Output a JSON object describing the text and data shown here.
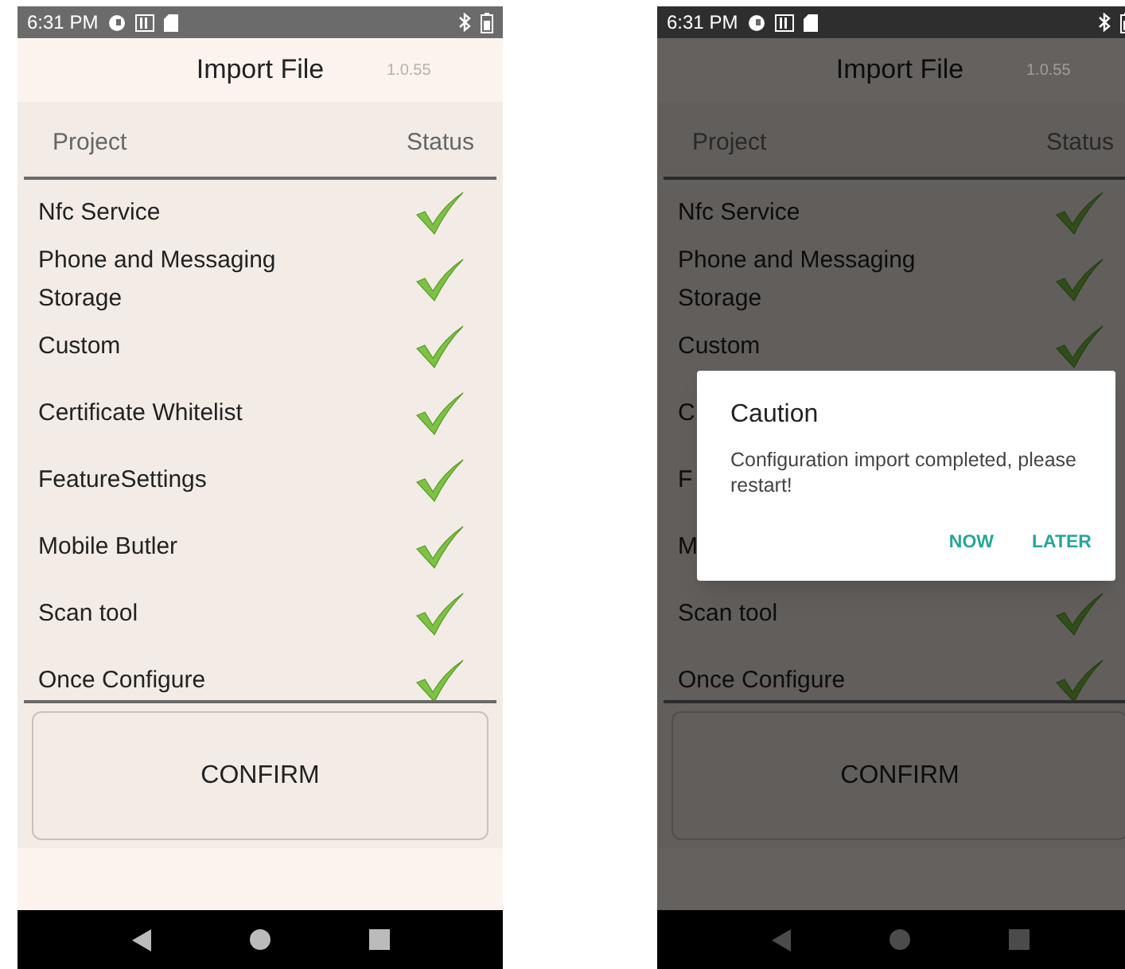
{
  "screens": [
    {
      "status_bar": {
        "time": "6:31 PM"
      },
      "title": "Import File",
      "version": "1.0.55",
      "columns": [
        "Project",
        "Status"
      ],
      "dimmed": false,
      "rows": [
        {
          "label": "Nfc Service",
          "checked": true
        },
        {
          "label": "Phone and Messaging Storage",
          "checked": true
        },
        {
          "label": "Custom",
          "checked": true
        },
        {
          "label": "Certificate Whitelist",
          "checked": true
        },
        {
          "label": "FeatureSettings",
          "checked": true
        },
        {
          "label": "Mobile Butler",
          "checked": true
        },
        {
          "label": "Scan tool",
          "checked": true
        },
        {
          "label": "Once Configure",
          "checked": true
        }
      ],
      "confirm_button": "CONFIRM"
    },
    {
      "status_bar": {
        "time": "6:31 PM"
      },
      "title": "Import File",
      "version": "1.0.55",
      "columns": [
        "Project",
        "Status"
      ],
      "dimmed": true,
      "rows": [
        {
          "label": "Nfc Service",
          "checked": true
        },
        {
          "label": "Phone and Messaging Storage",
          "checked": true
        },
        {
          "label": "Custom",
          "checked": true
        },
        {
          "label": "C"
        },
        {
          "label": "F"
        },
        {
          "label": "M"
        },
        {
          "label": "Scan tool",
          "checked": true
        },
        {
          "label": "Once Configure",
          "checked": true
        }
      ],
      "confirm_button": "CONFIRM",
      "dialog": {
        "title": "Caution",
        "message": "Configuration import completed, please restart!",
        "buttons": [
          "NOW",
          "LATER"
        ]
      }
    }
  ]
}
